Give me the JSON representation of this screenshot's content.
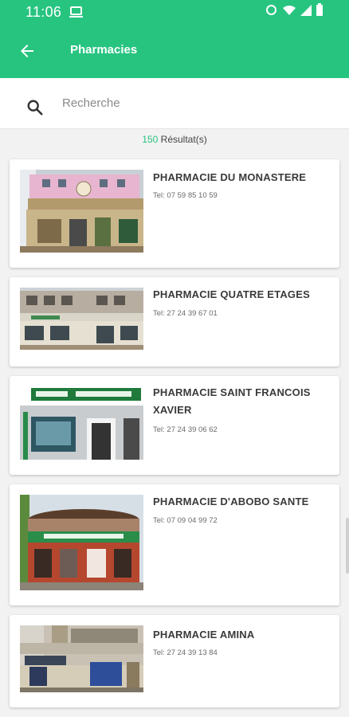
{
  "status": {
    "time": "11:06"
  },
  "header": {
    "title": "Pharmacies"
  },
  "search": {
    "placeholder": "Recherche"
  },
  "results": {
    "count": "150",
    "label": "Résultat(s)"
  },
  "pharmacies": [
    {
      "name": "PHARMACIE DU MONASTERE",
      "tel": "Tel: 07 59 85 10 59"
    },
    {
      "name": "PHARMACIE QUATRE ETAGES",
      "tel": "Tel: 27 24 39 67 01"
    },
    {
      "name": "PHARMACIE SAINT FRANCOIS XAVIER",
      "tel": "Tel: 27 24 39 06 62"
    },
    {
      "name": "PHARMACIE D'ABOBO SANTE",
      "tel": "Tel: 07 09 04 99 72"
    },
    {
      "name": "PHARMACIE AMINA",
      "tel": "Tel: 27 24 39 13 84"
    }
  ],
  "colors": {
    "accent": "#27c47f"
  }
}
